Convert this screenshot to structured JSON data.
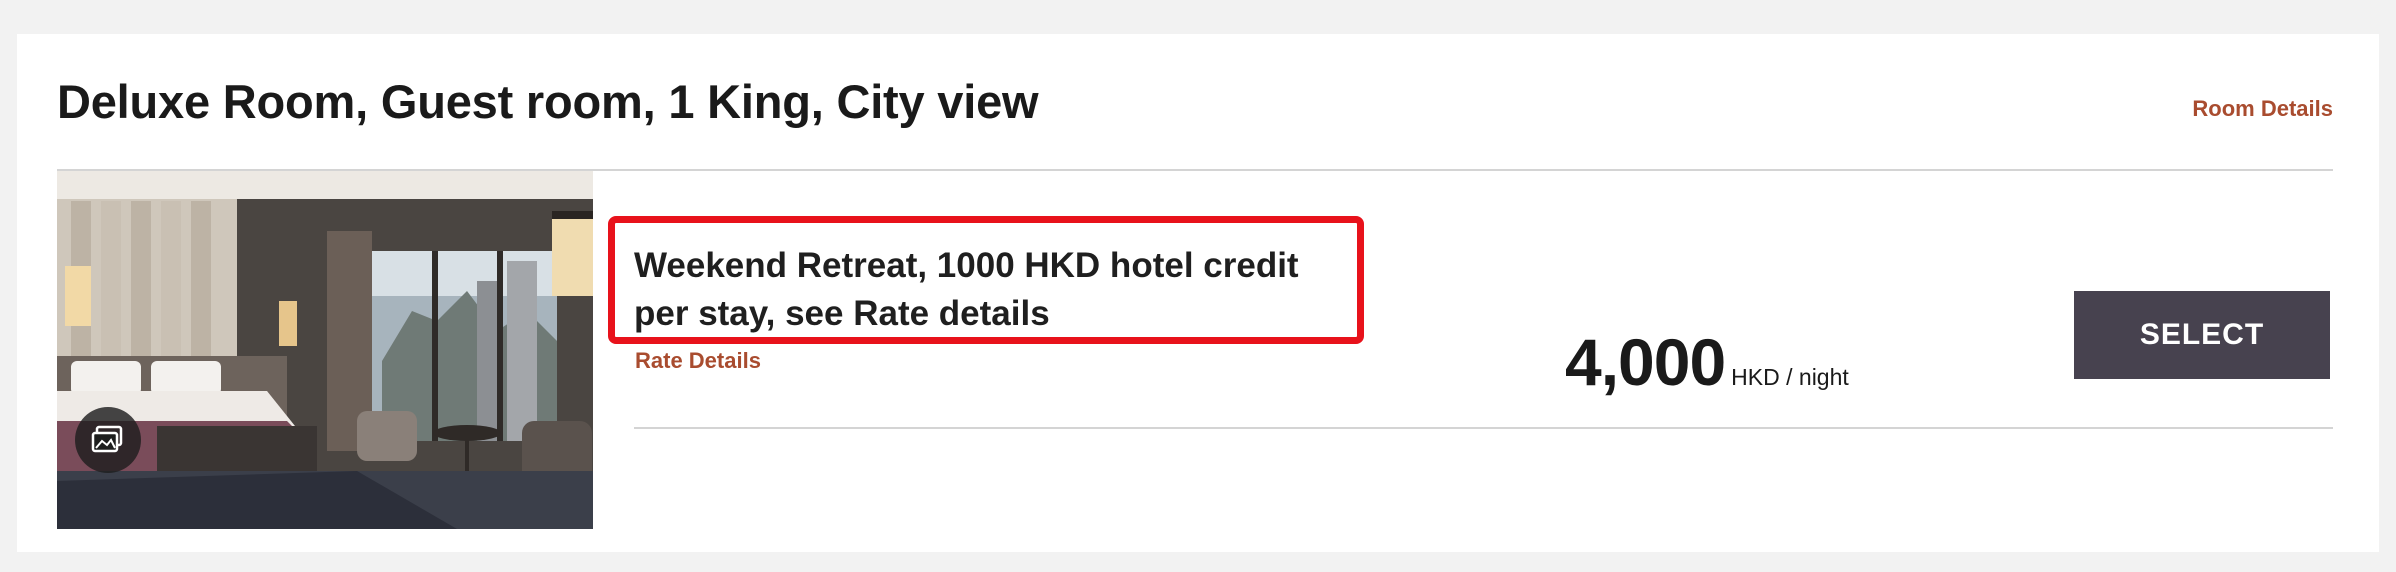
{
  "room": {
    "title": "Deluxe Room, Guest room, 1 King, City view",
    "details_link": "Room Details"
  },
  "rate": {
    "name": "Weekend Retreat, 1000 HKD hotel credit per stay, see Rate details",
    "details_link": "Rate Details",
    "price": "4,000",
    "unit": "HKD / night"
  },
  "actions": {
    "select_label": "SELECT"
  },
  "icons": {
    "gallery": "gallery-icon"
  },
  "colors": {
    "link": "#a94c2f",
    "button_bg": "#47424f",
    "highlight": "#e8121b"
  }
}
